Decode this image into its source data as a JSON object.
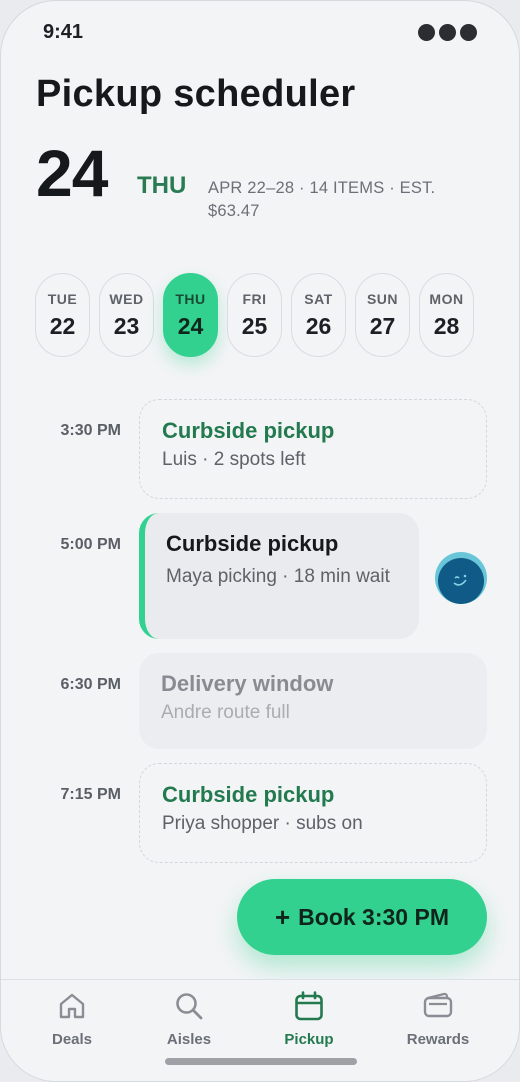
{
  "status_bar": {
    "time": "9:41",
    "menu_icon": "more-dots-icon"
  },
  "header": {
    "title": "Pickup scheduler",
    "day_number": "24",
    "day_of_week": "THU",
    "meta": "APR 22–28 · 14 ITEMS · EST. $63.47"
  },
  "days": [
    {
      "dow": "TUE",
      "num": "22",
      "selected": false
    },
    {
      "dow": "WED",
      "num": "23",
      "selected": false
    },
    {
      "dow": "THU",
      "num": "24",
      "selected": true
    },
    {
      "dow": "FRI",
      "num": "25",
      "selected": false
    },
    {
      "dow": "SAT",
      "num": "26",
      "selected": false
    },
    {
      "dow": "SUN",
      "num": "27",
      "selected": false
    },
    {
      "dow": "MON",
      "num": "28",
      "selected": false
    }
  ],
  "slots": [
    {
      "time": "3:30 PM",
      "title": "Curbside pickup",
      "subtitle": "Luis · 2 spots left",
      "state": "open"
    },
    {
      "time": "5:00 PM",
      "title": "Curbside pickup",
      "subtitle": "Maya picking · 18 min wait",
      "state": "selected"
    },
    {
      "time": "6:30 PM",
      "title": "Delivery window",
      "subtitle": "Andre route full",
      "state": "full"
    },
    {
      "time": "7:15 PM",
      "title": "Curbside pickup",
      "subtitle": "Priya shopper · subs on",
      "state": "open"
    }
  ],
  "book_button": {
    "label": "Book 3:30 PM",
    "icon": "plus-icon"
  },
  "tabs": [
    {
      "label": "Deals",
      "icon": "home-icon",
      "active": false
    },
    {
      "label": "Aisles",
      "icon": "search-icon",
      "active": false
    },
    {
      "label": "Pickup",
      "icon": "calendar-icon",
      "active": true
    },
    {
      "label": "Rewards",
      "icon": "wallet-icon",
      "active": false
    }
  ],
  "colors": {
    "accent": "#33d18f",
    "accent_text": "#247a4f",
    "background": "#f3f4f6"
  }
}
